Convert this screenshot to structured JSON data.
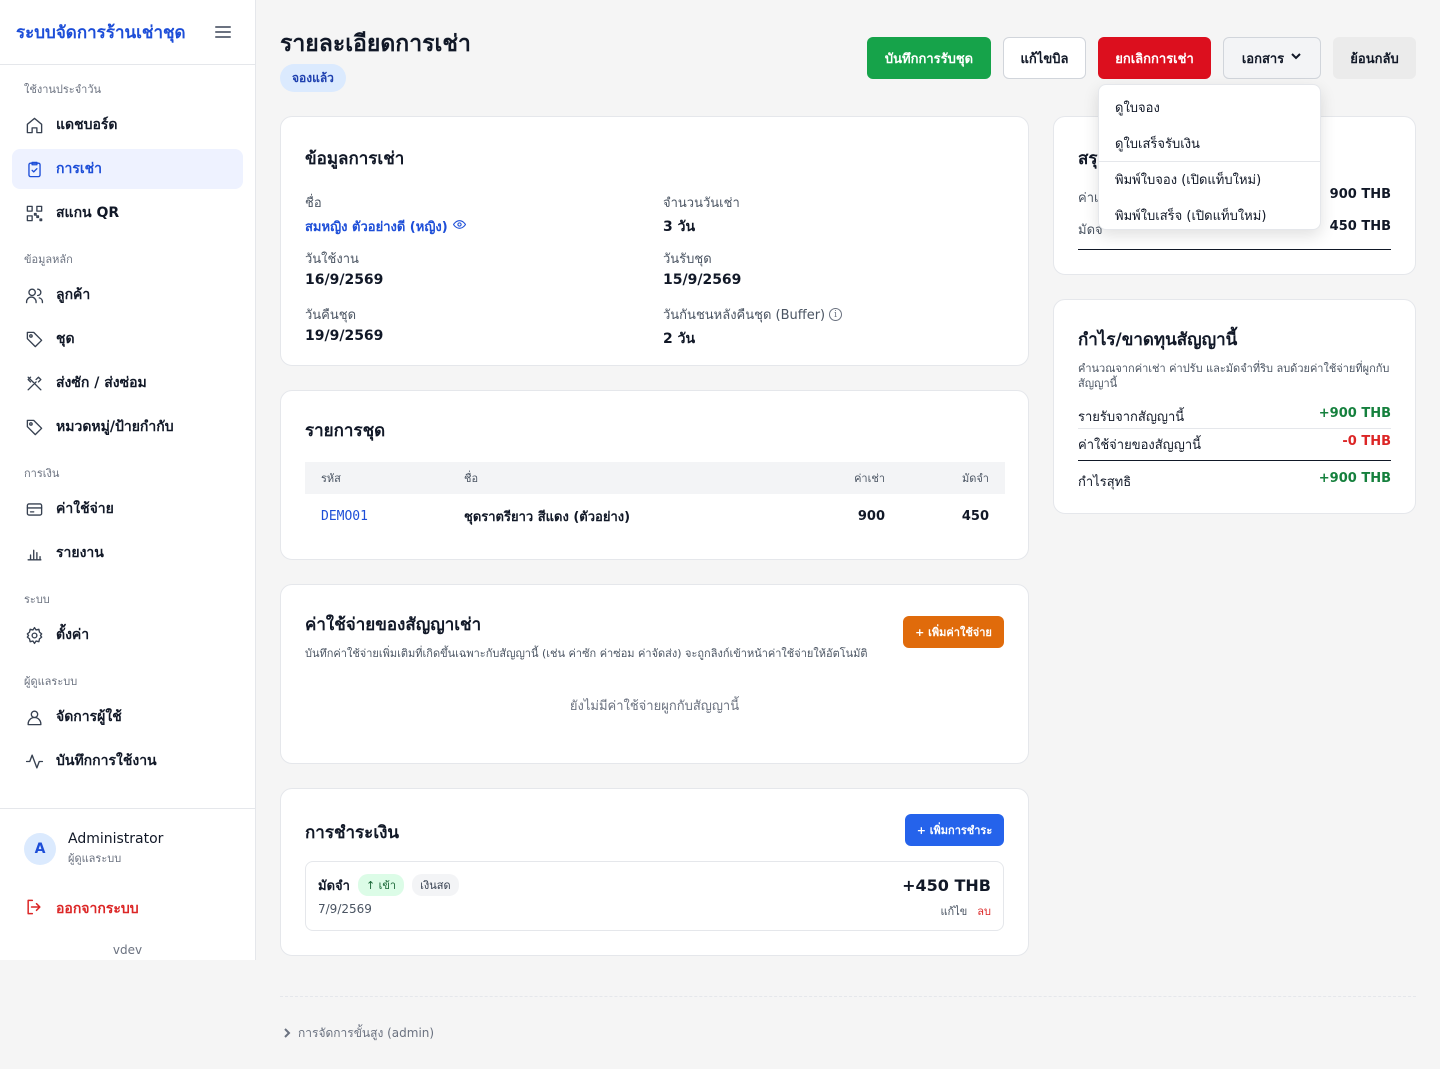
{
  "app": {
    "title": "ระบบจัดการร้านเช่าชุด",
    "version": "vdev"
  },
  "sidebar": {
    "sections": [
      {
        "label": "ใช้งานประจำวัน"
      },
      {
        "label": "ข้อมูลหลัก"
      },
      {
        "label": "การเงิน"
      },
      {
        "label": "ระบบ"
      },
      {
        "label": "ผู้ดูแลระบบ"
      }
    ],
    "items": [
      {
        "label": "แดชบอร์ด",
        "icon": "home-icon"
      },
      {
        "label": "การเช่า",
        "icon": "clipboard-icon",
        "active": true
      },
      {
        "label": "สแกน QR",
        "icon": "qr-icon"
      },
      {
        "label": "ลูกค้า",
        "icon": "users-icon"
      },
      {
        "label": "ชุด",
        "icon": "tag-icon"
      },
      {
        "label": "ส่งซัก / ส่งซ่อม",
        "icon": "tools-icon"
      },
      {
        "label": "หมวดหมู่/ป้ายกำกับ",
        "icon": "tag-icon"
      },
      {
        "label": "ค่าใช้จ่าย",
        "icon": "card-icon"
      },
      {
        "label": "รายงาน",
        "icon": "chart-icon"
      },
      {
        "label": "ตั้งค่า",
        "icon": "gear-icon"
      },
      {
        "label": "จัดการผู้ใช้",
        "icon": "user-icon"
      },
      {
        "label": "บันทึกการใช้งาน",
        "icon": "activity-icon"
      }
    ],
    "user": {
      "initial": "A",
      "name": "Administrator",
      "role": "ผู้ดูแลระบบ"
    },
    "logout": "ออกจากระบบ"
  },
  "header": {
    "title": "รายละเอียดการเช่า",
    "status": "จองแล้ว",
    "buttons": {
      "pickup": "บันทึกการรับชุด",
      "edit_bill": "แก้ไขบิล",
      "cancel": "ยกเลิกการเช่า",
      "documents": "เอกสาร",
      "back": "ย้อนกลับ"
    }
  },
  "documents_menu": [
    "ดูใบจอง",
    "ดูใบเสร็จรับเงิน",
    "พิมพ์ใบจอง (เปิดแท็บใหม่)",
    "พิมพ์ใบเสร็จ (เปิดแท็บใหม่)"
  ],
  "rental_info": {
    "title": "ข้อมูลการเช่า",
    "name_label": "ชื่อ",
    "name_value": "สมหญิง ตัวอย่างดี (หญิง)",
    "days_label": "จำนวนวันเช่า",
    "days_value": "3 วัน",
    "use_date_label": "วันใช้งาน",
    "use_date_value": "16/9/2569",
    "pickup_date_label": "วันรับชุด",
    "pickup_date_value": "15/9/2569",
    "return_date_label": "วันคืนชุด",
    "return_date_value": "19/9/2569",
    "buffer_label": "วันกันชนหลังคืนชุด (Buffer)",
    "buffer_value": "2 วัน"
  },
  "items": {
    "title": "รายการชุด",
    "headers": [
      "รหัส",
      "ชื่อ",
      "ค่าเช่า",
      "มัดจำ"
    ],
    "rows": [
      {
        "code": "DEMO01",
        "name": "ชุดราตรียาว สีแดง (ตัวอย่าง)",
        "rent": "900",
        "deposit": "450"
      }
    ]
  },
  "expenses": {
    "title": "ค่าใช้จ่ายของสัญญาเช่า",
    "subtitle": "บันทึกค่าใช้จ่ายเพิ่มเติมที่เกิดขึ้นเฉพาะกับสัญญานี้ (เช่น ค่าซัก ค่าซ่อม ค่าจัดส่ง) จะถูกลิงก์เข้าหน้าค่าใช้จ่ายให้อัตโนมัติ",
    "add_button": "+ เพิ่มค่าใช้จ่าย",
    "empty": "ยังไม่มีค่าใช้จ่ายผูกกับสัญญานี้"
  },
  "payments": {
    "title": "การชำระเงิน",
    "add_button": "+ เพิ่มการชำระ",
    "rows": [
      {
        "type": "มัดจำ",
        "direction": "↑ เข้า",
        "method": "เงินสด",
        "date": "7/9/2569",
        "amount": "+450 THB",
        "edit": "แก้ไข",
        "delete": "ลบ"
      }
    ]
  },
  "summary": {
    "title": "สรุ",
    "rent_label": "ค่าเ",
    "rent_value": "900 THB",
    "deposit_label": "มัดจ",
    "deposit_value": "450 THB"
  },
  "profit": {
    "title": "กำไร/ขาดทุนสัญญานี้",
    "subtitle": "คำนวณจากค่าเช่า ค่าปรับ และมัดจำที่ริบ ลบด้วยค่าใช้จ่ายที่ผูกกับสัญญานี้",
    "income_label": "รายรับจากสัญญานี้",
    "income_value": "+900 THB",
    "expense_label": "ค่าใช้จ่ายของสัญญานี้",
    "expense_value": "-0 THB",
    "net_label": "กำไรสุทธิ",
    "net_value": "+900 THB"
  },
  "footer": {
    "admin_link": "การจัดการขั้นสูง (admin)"
  },
  "colors": {
    "primary": "#1d4ed8",
    "success": "#16a34a",
    "danger": "#dc0f1e",
    "warning": "#e06b0b"
  }
}
